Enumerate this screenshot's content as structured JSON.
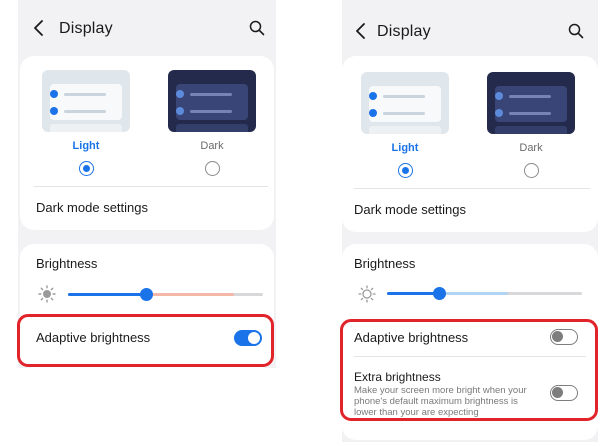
{
  "screens": [
    {
      "header": {
        "title": "Display",
        "back_icon": "chevron-left-icon",
        "search_icon": "search-icon"
      },
      "theme": {
        "light_label": "Light",
        "dark_label": "Dark",
        "selected": "Light"
      },
      "dark_mode_settings_label": "Dark mode settings",
      "brightness": {
        "label": "Brightness",
        "level": 0.4,
        "adaptive_range_end": 0.85,
        "icon": "sun-icon"
      },
      "adaptive_brightness": {
        "label": "Adaptive brightness",
        "enabled": true
      }
    },
    {
      "header": {
        "title": "Display",
        "back_icon": "chevron-left-icon",
        "search_icon": "search-icon"
      },
      "theme": {
        "light_label": "Light",
        "dark_label": "Dark",
        "selected": "Light"
      },
      "dark_mode_settings_label": "Dark mode settings",
      "brightness": {
        "label": "Brightness",
        "level": 0.27,
        "adaptive_range_end": 0.62,
        "icon": "sun-icon"
      },
      "adaptive_brightness": {
        "label": "Adaptive brightness",
        "enabled": false
      },
      "extra_brightness": {
        "label": "Extra brightness",
        "description_lines": [
          "Make your screen more bright when your",
          "phone's default maximum brightness is",
          "lower than your are expecting"
        ],
        "enabled": false
      }
    }
  ],
  "colors": {
    "accent": "#1a73e8",
    "highlight": "#e0242a",
    "background": "#f2f2f4",
    "card": "#ffffff"
  }
}
